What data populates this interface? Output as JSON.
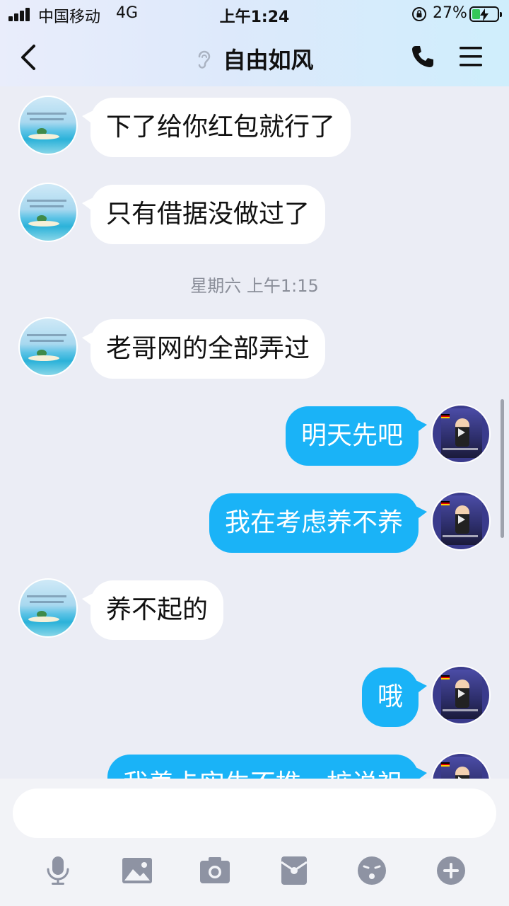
{
  "status_bar": {
    "carrier": "中国移动",
    "network": "4G",
    "time": "上午1:24",
    "battery_percent": "27%"
  },
  "nav": {
    "title": "自由如风",
    "icons": [
      "back-arrow-icon",
      "ear-icon",
      "phone-icon",
      "menu-icon"
    ]
  },
  "messages": [
    {
      "side": "left",
      "text": "下了给你红包就行了"
    },
    {
      "side": "left",
      "text": "只有借据没做过了"
    },
    {
      "type": "timestamp",
      "text": "星期六 上午1:15"
    },
    {
      "side": "left",
      "text": "老哥网的全部弄过"
    },
    {
      "side": "right",
      "text": "明天先吧"
    },
    {
      "side": "right",
      "text": "我在考虑养不养"
    },
    {
      "side": "left",
      "text": "养不起的"
    },
    {
      "side": "right",
      "text": "哦"
    },
    {
      "side": "right",
      "text": "我养卡实生不推一桩说祖"
    }
  ],
  "input": {
    "value": "",
    "placeholder": ""
  },
  "toolbar": {
    "icons": [
      "microphone-icon",
      "image-icon",
      "camera-icon",
      "red-packet-icon",
      "emoji-icon",
      "plus-icon"
    ]
  },
  "colors": {
    "bubble_right": "#1ab3f7",
    "bubble_left": "#ffffff",
    "chat_background": "#ebedf5",
    "toolbar_icon": "#8e93a3"
  }
}
